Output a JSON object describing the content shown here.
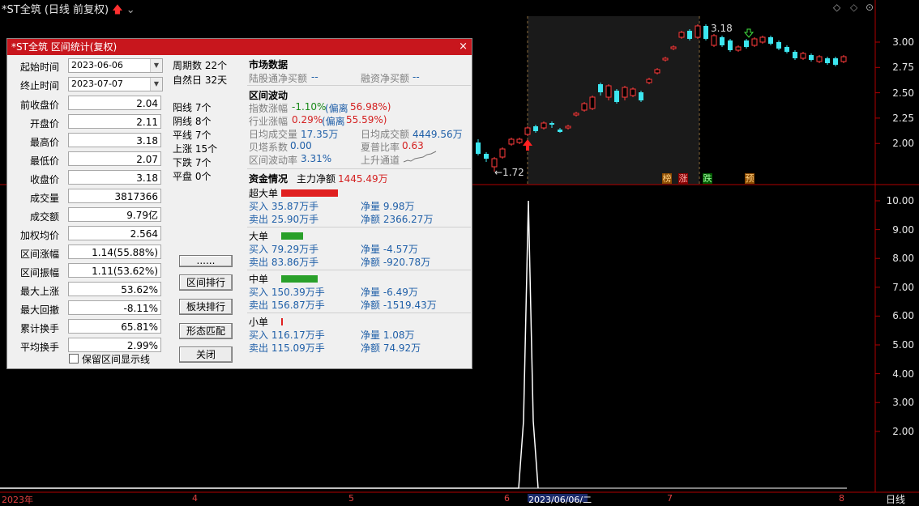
{
  "window": {
    "title": "*ST全筑 (日线 前复权)"
  },
  "price_axis": {
    "labels": [
      "3.00",
      "2.75",
      "2.50",
      "2.25",
      "2.00"
    ]
  },
  "volume_axis": {
    "labels": [
      "10.00",
      "9.00",
      "8.00",
      "7.00",
      "6.00",
      "5.00",
      "4.00",
      "3.00",
      "2.00"
    ]
  },
  "chart_marks": {
    "high_label": "3.18",
    "low_label": "←1.72"
  },
  "event_tags": [
    "榜",
    "涨",
    "跌",
    "预"
  ],
  "time_axis": {
    "labels": [
      "2023年",
      "4",
      "5",
      "6",
      "2023/06/06/二",
      "7",
      "8"
    ],
    "corner": "日线"
  },
  "colors": {
    "up": "#ff3b3b",
    "down": "#3ce6f0",
    "grid": "#b00000",
    "dialog_title": "#c8161d"
  },
  "dialog": {
    "title": "*ST全筑 区间统计(复权)",
    "close_icon": "×",
    "start": {
      "label": "起始时间",
      "value": "2023-06-06"
    },
    "end": {
      "label": "终止时间",
      "value": "2023-07-07"
    },
    "fields": [
      {
        "label": "前收盘价",
        "value": "2.04"
      },
      {
        "label": "开盘价",
        "value": "2.11"
      },
      {
        "label": "最高价",
        "value": "3.18"
      },
      {
        "label": "最低价",
        "value": "2.07"
      },
      {
        "label": "收盘价",
        "value": "3.18"
      },
      {
        "label": "成交量",
        "value": "3817366"
      },
      {
        "label": "成交额",
        "value": "9.79亿"
      },
      {
        "label": "加权均价",
        "value": "2.564"
      },
      {
        "label": "区间涨幅",
        "value": "1.14(55.88%)"
      },
      {
        "label": "区间振幅",
        "value": "1.11(53.62%)"
      },
      {
        "label": "最大上涨",
        "value": "53.62%"
      },
      {
        "label": "最大回撤",
        "value": "-8.11%"
      },
      {
        "label": "累计换手",
        "value": "65.81%"
      },
      {
        "label": "平均换手",
        "value": "2.99%"
      }
    ],
    "keep_line_checkbox": "保留区间显示线",
    "period": [
      "周期数 22个",
      "自然日 32天"
    ],
    "counts": [
      "阳线 7个",
      "阴线 8个",
      "平线 7个",
      "上涨 15个",
      "下跌 7个",
      "平盘 0个"
    ],
    "buttons": [
      "......",
      "区间排行",
      "板块排行",
      "形态匹配",
      "关闭"
    ],
    "market": {
      "heading": "市场数据",
      "hk_label": "陆股通净买额",
      "hk_value": "--",
      "margin_label": "融资净买额",
      "margin_value": "--"
    },
    "volatility": {
      "heading": "区间波动",
      "index_label": "指数涨幅",
      "index_value": "-1.10%",
      "index_dev_label": "(偏离",
      "index_dev": "56.98%)",
      "industry_label": "行业涨幅",
      "industry_value": "0.29%",
      "industry_dev_label": "(偏离",
      "industry_dev": "55.59%)",
      "avg_vol_label": "日均成交量",
      "avg_vol_value": "17.35万",
      "avg_amt_label": "日均成交额",
      "avg_amt_value": "4449.56万",
      "beta_label": "贝塔系数",
      "beta_value": "0.00",
      "sharpe_label": "夏普比率",
      "sharpe_value": "0.63",
      "vol_rate_label": "区间波动率",
      "vol_rate_value": "3.31%",
      "trend_label": "上升通道"
    },
    "capital": {
      "heading": "资金情况",
      "main_label": "主力净额",
      "main_value": "1445.49万",
      "groups": [
        {
          "name": "超大单",
          "bar_fraction": 0.9,
          "bar_color": "#e02020",
          "buy": "买入 35.87万手",
          "sell": "卖出 25.90万手",
          "net_qty": "净量 9.98万",
          "net_amt": "净额 2366.27万"
        },
        {
          "name": "大单",
          "bar_fraction": 0.35,
          "bar_color": "#2aa02a",
          "buy": "买入 79.29万手",
          "sell": "卖出 83.86万手",
          "net_qty": "净量 -4.57万",
          "net_amt": "净额 -920.78万"
        },
        {
          "name": "中单",
          "bar_fraction": 0.58,
          "bar_color": "#2aa02a",
          "buy": "买入 150.39万手",
          "sell": "卖出 156.87万手",
          "net_qty": "净量 -6.49万",
          "net_amt": "净额 -1519.43万"
        },
        {
          "name": "小单",
          "bar_fraction": 0.03,
          "bar_color": "#e02020",
          "buy": "买入 116.17万手",
          "sell": "卖出 115.09万手",
          "net_qty": "净量 1.08万",
          "net_amt": "净额 74.92万"
        }
      ]
    }
  }
}
